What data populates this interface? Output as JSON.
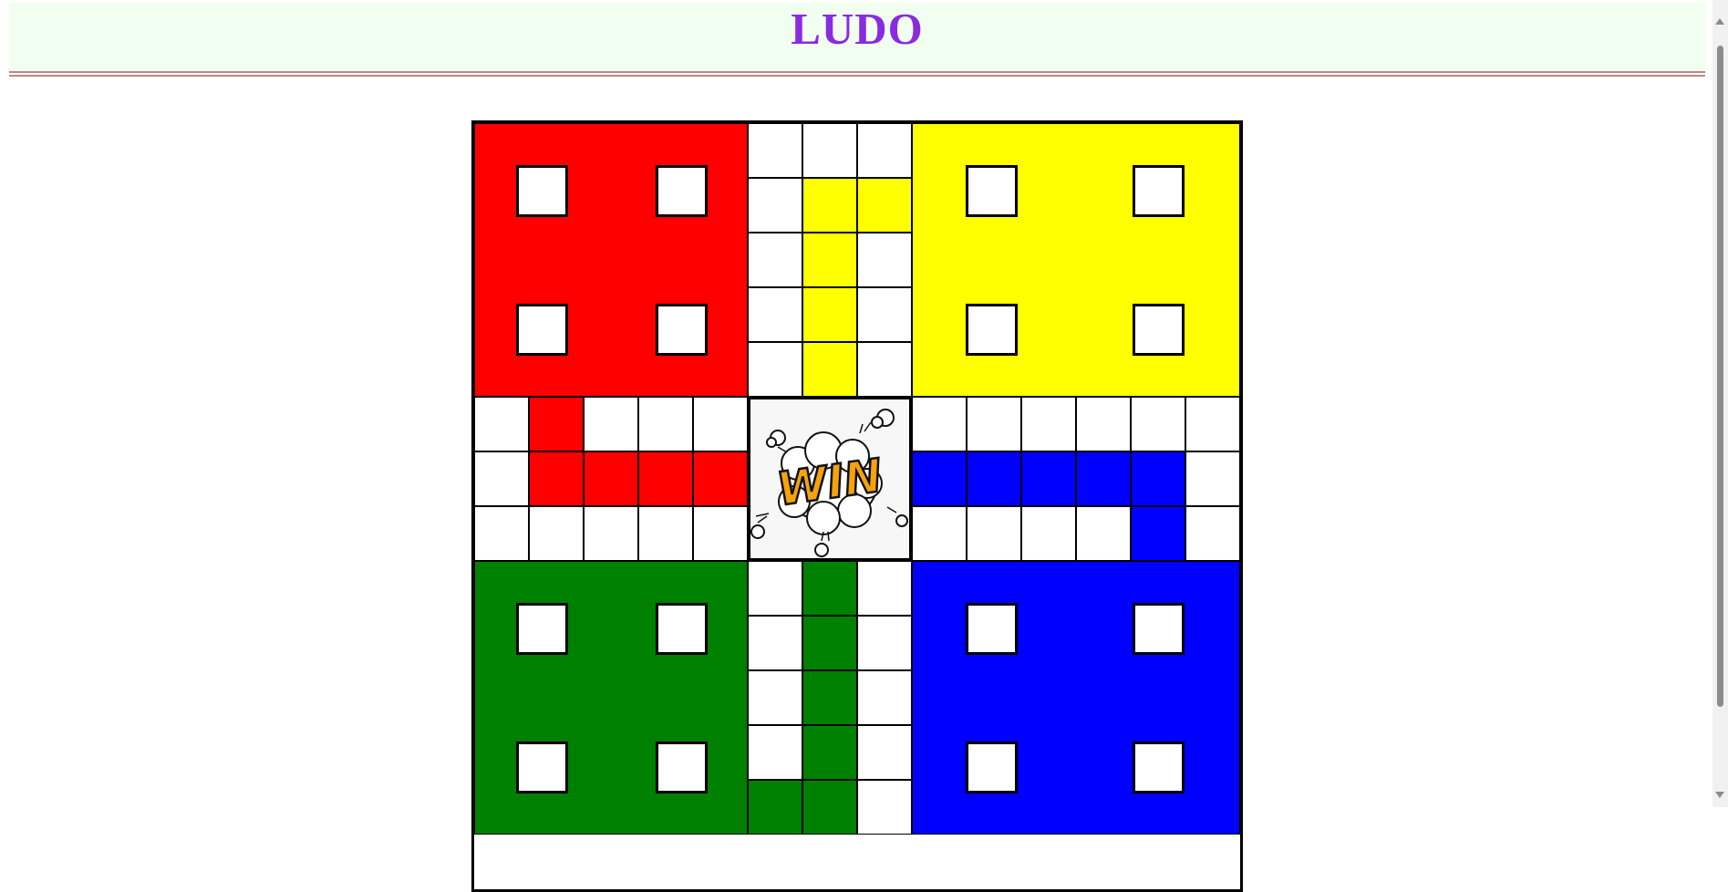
{
  "header": {
    "title": "LUDO"
  },
  "board": {
    "colors": {
      "red": "#ff0000",
      "yellow": "#ffff00",
      "green": "#008000",
      "blue": "#0000ff",
      "track": "#ffffff",
      "header_bg": "#f0fff0",
      "title_color": "#8a2be2"
    },
    "yards": [
      "red",
      "yellow",
      "green",
      "blue"
    ],
    "center": {
      "label": "WIN",
      "icon": "win-burst-icon"
    }
  }
}
